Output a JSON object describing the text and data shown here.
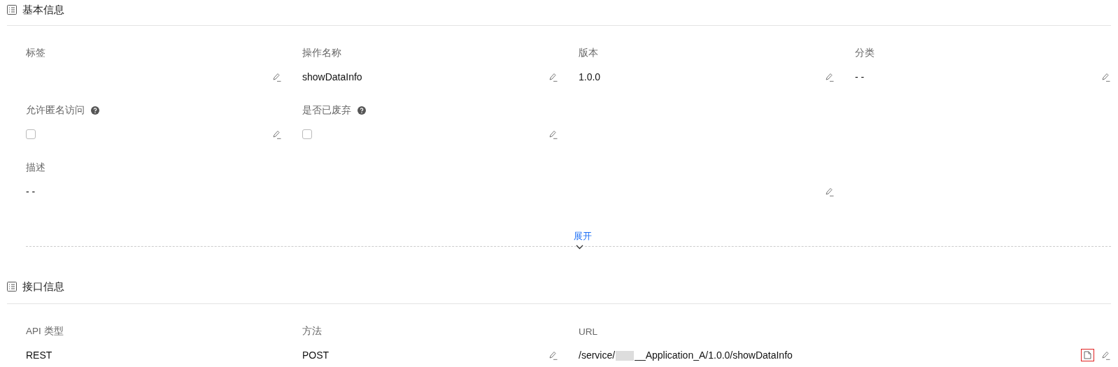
{
  "sections": [
    {
      "title": "基本信息",
      "fields": [
        {
          "label": "标签",
          "kind": "text",
          "help": false,
          "editable": true
        },
        {
          "label": "操作名称",
          "kind": "text",
          "value": "showDataInfo",
          "help": false,
          "editable": true
        },
        {
          "label": "版本",
          "kind": "text",
          "value": "1.0.0",
          "help": false,
          "editable": true
        },
        {
          "label": "分类",
          "kind": "text",
          "value": "- -",
          "help": false,
          "editable": true
        },
        {
          "label": "允许匿名访问",
          "kind": "checkbox",
          "checked": false,
          "help": true,
          "editable": true
        },
        {
          "label": "是否已废弃",
          "kind": "checkbox",
          "checked": false,
          "help": true,
          "editable": true
        },
        {
          "label": "描述",
          "kind": "description",
          "value": "- -",
          "help": false,
          "editable": true
        }
      ],
      "expand": "展开"
    },
    {
      "title": "接口信息",
      "fields": [
        {
          "label": "API 类型",
          "kind": "text",
          "value": "REST",
          "help": false,
          "editable": false
        },
        {
          "label": "方法",
          "kind": "text",
          "value": "POST",
          "help": false,
          "editable": true
        },
        {
          "label": "URL",
          "kind": "url",
          "value_before": "/service/",
          "value_after": "__Application_A/1.0.0/showDataInfo",
          "help": false,
          "editable": true,
          "copy": true
        }
      ]
    }
  ]
}
